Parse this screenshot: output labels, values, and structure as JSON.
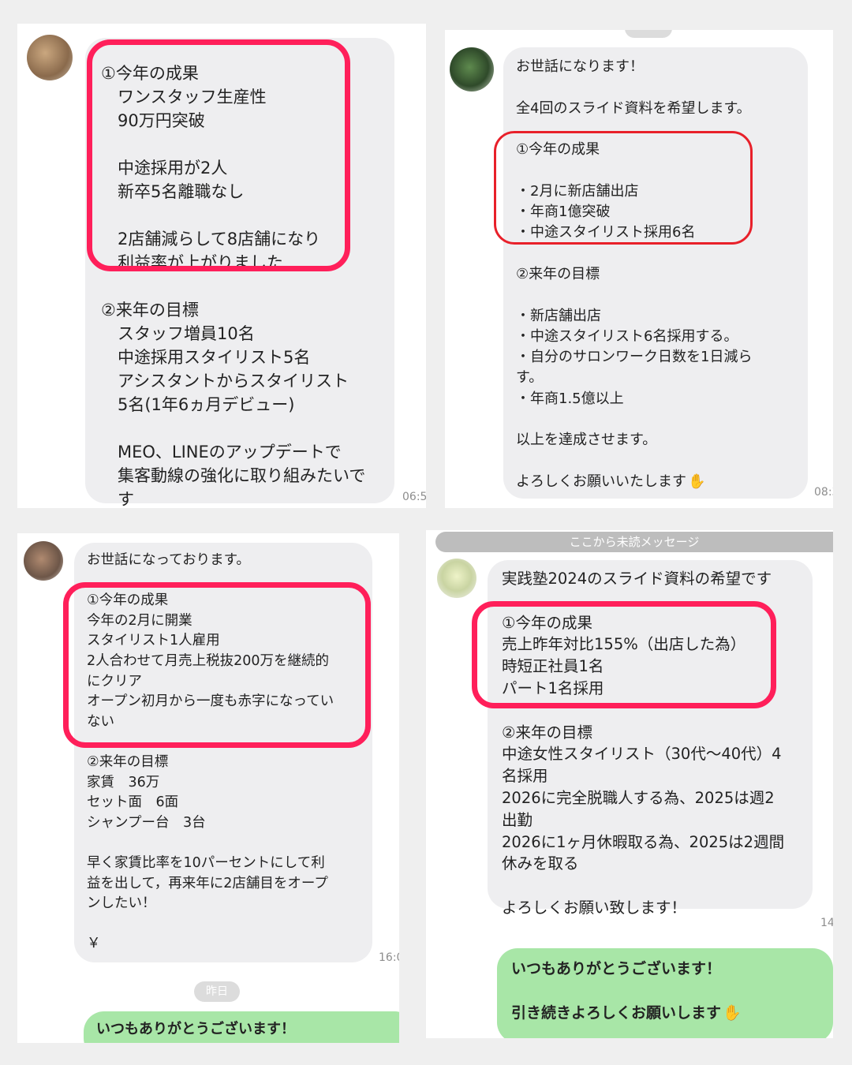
{
  "chat1": {
    "messages": [
      "①今年の成果",
      "　ワンスタッフ生産性",
      "　90万円突破",
      "",
      "　中途採用が2人",
      "　新卒5名離職なし",
      "",
      "　2店舗減らして8店舗になり",
      "　利益率が上がりました",
      "",
      "②来年の目標",
      "　スタッフ増員10名",
      "　中途採用スタイリスト5名",
      "　アシスタントからスタイリスト",
      "　5名(1年6ヵ月デビュー)",
      "",
      "　MEO、LINEのアップデートで",
      "　集客動線の強化に取り組みたいで",
      "　す"
    ],
    "time": "06:5"
  },
  "chat2": {
    "messages": [
      "お世話になります！",
      "",
      "全4回のスライド資料を希望します。",
      "",
      "①今年の成果",
      "",
      "・2月に新店舗出店",
      "・年商1億突破",
      "・中途スタイリスト採用6名",
      "",
      "②来年の目標",
      "",
      "・新店舗出店",
      "・中途スタイリスト6名採用する。",
      "・自分のサロンワーク日数を1日減ら",
      "す。",
      "・年商1.5億以上",
      "",
      "以上を達成させます。",
      "",
      "よろしくお願いいたします"
    ],
    "time": "08:3",
    "emoji_icon": "praying-hands-icon"
  },
  "chat3": {
    "messages": [
      "お世話になっております。",
      "",
      "①今年の成果",
      "今年の2月に開業",
      "スタイリスト1人雇用",
      "2人合わせて月売上税抜200万を継続的",
      "にクリア",
      "オープン初月から一度も赤字になってい",
      "ない",
      "",
      "②来年の目標",
      "家賃　36万",
      "セット面　6面",
      "シャンプー台　3台",
      "",
      "早く家賃比率を10パーセントにして利",
      "益を出して，再来年に2店舗目をオープ",
      "ンしたい！",
      "",
      "￥"
    ],
    "time": "16:0",
    "date_pill": "昨日",
    "reply": "いつもありがとうございます！"
  },
  "chat4": {
    "unread_banner": "ここから未読メッセージ",
    "messages": [
      "実践塾2024のスライド資料の希望です",
      "",
      "①今年の成果",
      "売上昨年対比155%（出店した為）",
      "時短正社員1名",
      "パート1名採用",
      "",
      "②来年の目標",
      "中途女性スタイリスト（30代〜40代）4",
      "名採用",
      "2026に完全脱職人する為、2025は週2",
      "出勤",
      "2026に1ヶ月休暇取る為、2025は2週間",
      "休みを取る",
      "",
      "よろしくお願い致します！"
    ],
    "time": "14",
    "reply_lines": [
      "いつもありがとうございます！",
      "",
      "引き続きよろしくお願いします"
    ],
    "emoji_icon": "praying-hands-icon"
  },
  "colors": {
    "highlight_pink": "#ff1f5a",
    "highlight_red": "#e8202a",
    "incoming_bubble": "#eeeef0",
    "outgoing_bubble": "#a8e6a7"
  }
}
